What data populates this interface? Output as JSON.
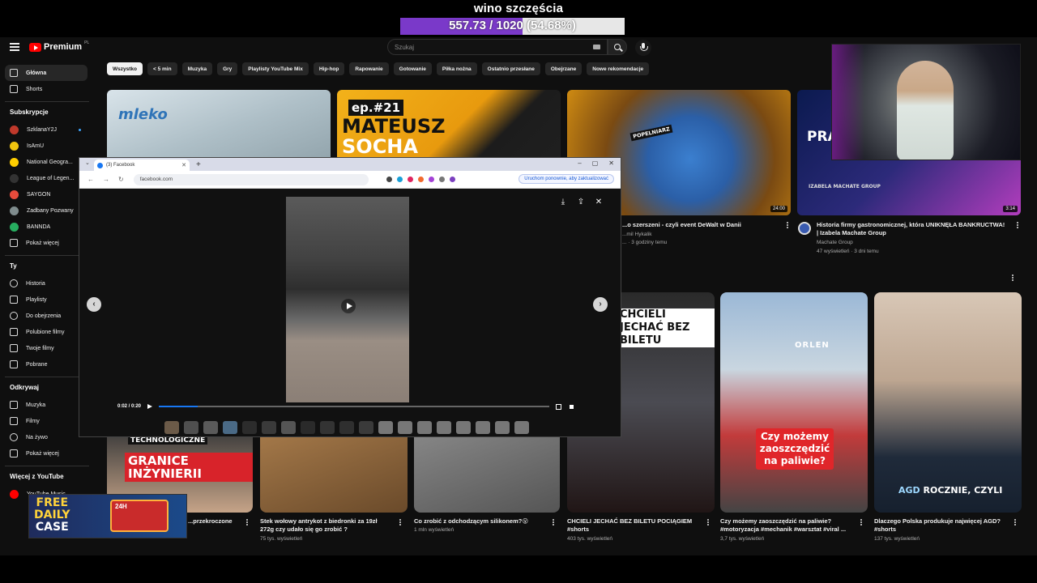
{
  "stream": {
    "title": "wino szczęścia",
    "progress_text": "557.73 / 1020 (54.68%)",
    "progress_fraction": 0.5468,
    "accent": "#7a39c9"
  },
  "youtube": {
    "logo": "Premium",
    "logo_region": "PL",
    "search_placeholder": "Szukaj",
    "sidebar": {
      "main": [
        {
          "label": "Główna",
          "icon": "home-icon",
          "active": true
        },
        {
          "label": "Shorts",
          "icon": "shorts-icon"
        }
      ],
      "subs_header": "Subskrypcje",
      "subs": [
        {
          "label": "SzklanaY2J",
          "color": "#c0392b",
          "live": true
        },
        {
          "label": "IsAmU",
          "color": "#f1c40f"
        },
        {
          "label": "National Geogra...",
          "color": "#ffce00"
        },
        {
          "label": "League of Legen...",
          "color": "#333333"
        },
        {
          "label": "SAYGON",
          "color": "#e74c3c"
        },
        {
          "label": "Zadbany Pozwany",
          "color": "#7f8c8d"
        },
        {
          "label": "BANNDA",
          "color": "#27ae60"
        },
        {
          "label": "Pokaż więcej",
          "icon": "chevron-down-icon"
        }
      ],
      "you_header": "Ty",
      "you": [
        {
          "label": "Historia",
          "icon": "history-icon"
        },
        {
          "label": "Playlisty",
          "icon": "playlist-icon"
        },
        {
          "label": "Do obejrzenia",
          "icon": "clock-icon"
        },
        {
          "label": "Polubione filmy",
          "icon": "like-icon"
        },
        {
          "label": "Twoje filmy",
          "icon": "video-icon"
        },
        {
          "label": "Pobrane",
          "icon": "download-icon"
        }
      ],
      "explore_header": "Odkrywaj",
      "explore": [
        {
          "label": "Muzyka",
          "icon": "music-icon"
        },
        {
          "label": "Filmy",
          "icon": "film-icon"
        },
        {
          "label": "Na żywo",
          "icon": "live-icon"
        },
        {
          "label": "Pokaż więcej",
          "icon": "chevron-down-icon"
        }
      ],
      "more_header": "Więcej z YouTube",
      "more": [
        {
          "label": "YouTube Music",
          "color": "#ff0000"
        }
      ]
    },
    "chips": [
      "Wszystko",
      "< 5 min",
      "Muzyka",
      "Gry",
      "Playlisty YouTube Mix",
      "Hip-hop",
      "Rapowanie",
      "Gotowanie",
      "Piłka nożna",
      "Ostatnio przesłane",
      "Obejrzane",
      "Nowe rekomendacje"
    ],
    "videos": [
      {
        "thumb_text": "mleko",
        "title": "",
        "channel": "",
        "stats": ""
      },
      {
        "thumb_ep": "ep.#21",
        "thumb_line1": "MATEUSZ",
        "thumb_line2": "SOCHA",
        "title": "",
        "channel": "",
        "stats": ""
      },
      {
        "thumb_badge": "POPELNIARZ",
        "duration": "24:00",
        "title": "...o szerszeni - czyli event DeWalt w Danii",
        "channel": "...mil Hykalik",
        "stats": "... · 3 godziny temu"
      },
      {
        "thumb_text": "PRA... SW...",
        "thumb_sub": "IZABELA MACHATE GROUP",
        "duration": "3:14",
        "title": "Historia firmy gastronomicznej, która UNIKNĘŁA BANKRUCTWA! | Izabela Machate Group",
        "channel": "Machate Group",
        "stats": "47 wyświetleń · 3 dni temu"
      }
    ],
    "shorts": [
      {
        "thumb_top": "TECHNOLOGICZNE",
        "thumb_text": "GRANICE INŻYNIERII",
        "title": "...przekroczone",
        "stats": ""
      },
      {
        "title": "Stek wołowy antrykot z biedronki za 19zł 272g czy udało się go zrobić ?",
        "stats": "75 tys. wyświetleń"
      },
      {
        "title": "Co zrobić z odchodzącym silikonem?😮",
        "stats": "1 mln wyświetleń"
      },
      {
        "thumb_text": "CHCIELI JECHAĆ BEZ BILETU",
        "title": "CHCIELI JECHAĆ BEZ BILETU POCIĄGIEM #shorts",
        "stats": "403 tys. wyświetleń"
      },
      {
        "thumb_brand": "ORLEN",
        "thumb_text": "Czy możemy zaoszczędzić na paliwie?",
        "title": "Czy możemy zaoszczędzić na paliwie? #motoryzacja #mechanik #warsztat #viral ...",
        "stats": "3,7 tys. wyświetleń"
      },
      {
        "thumb_text_hl": "AGD",
        "thumb_text": "ROCZNIE, CZYLI",
        "title": "Dlaczego Polska produkuje najwięcej AGD? #shorts",
        "stats": "137 tys. wyświetleń"
      }
    ]
  },
  "facebook_window": {
    "tab_title": "(3) Facebook",
    "url": "facebook.com",
    "update_button": "Uruchom ponownie, aby zaktualizować",
    "time": "0:02 / 0:20",
    "progress_fraction": 0.1
  },
  "promo": {
    "line1": "FREE",
    "line2": "DAILY",
    "line3": "CASE",
    "badge": "24H"
  }
}
